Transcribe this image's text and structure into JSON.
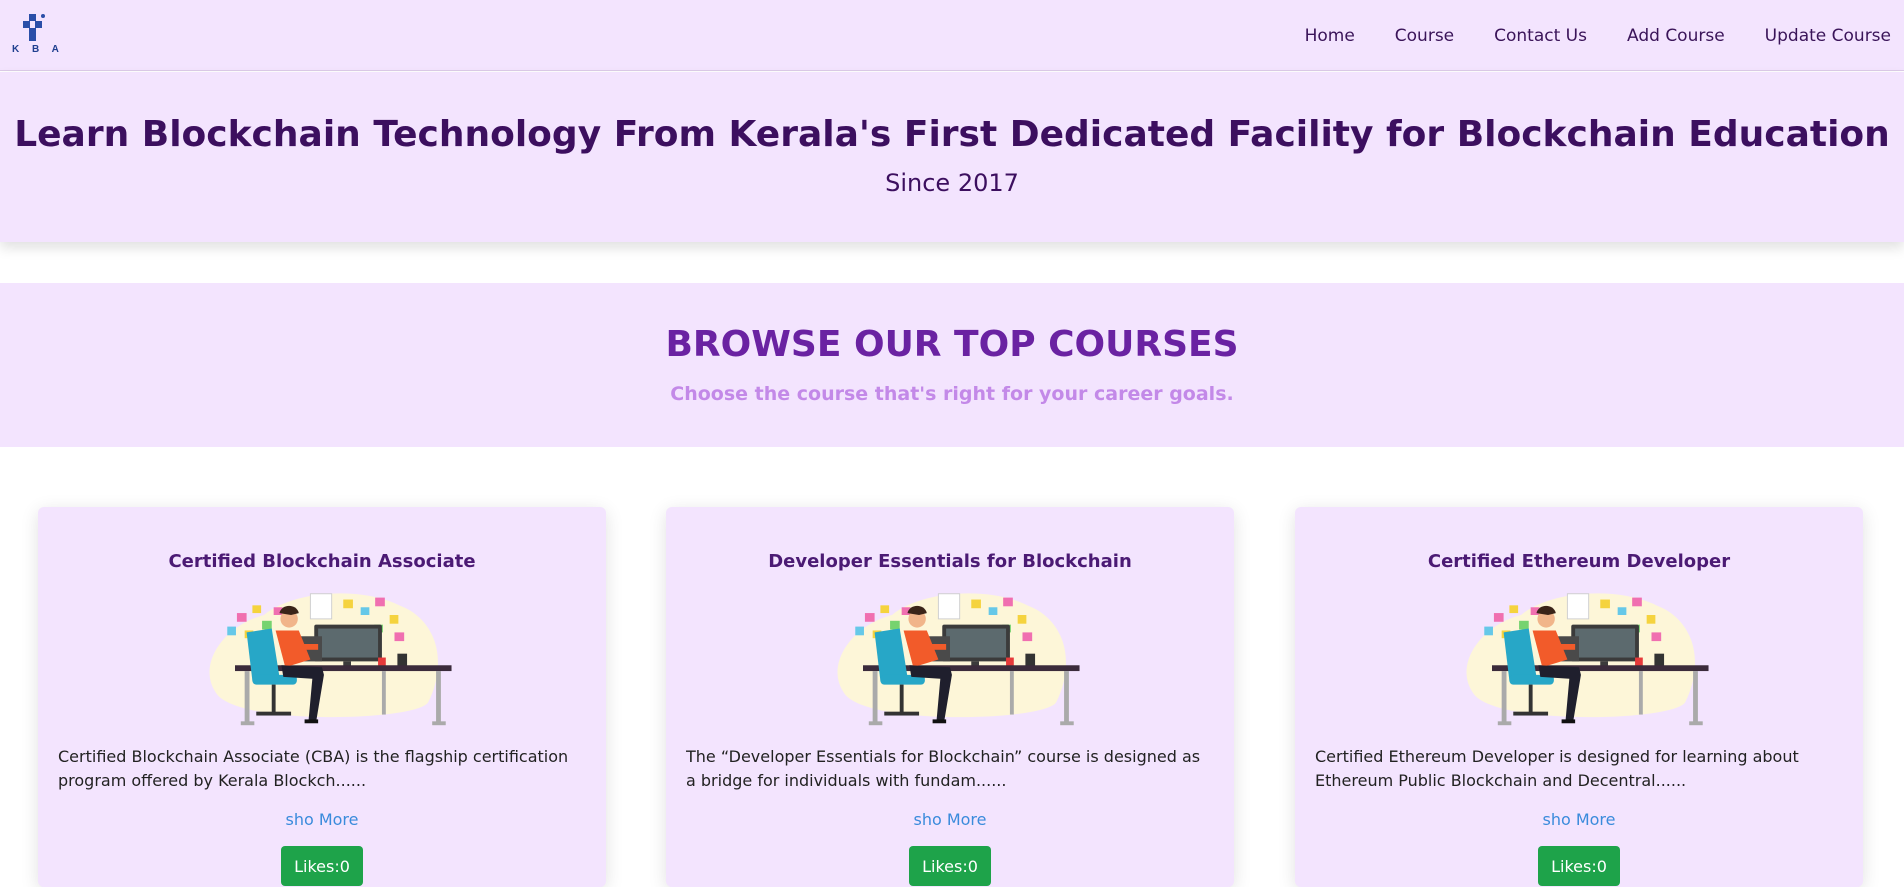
{
  "logo": {
    "text": "K B A",
    "icon": "kba-cube-logo-icon"
  },
  "nav": {
    "items": [
      "Home",
      "Course",
      "Contact Us",
      "Add Course",
      "Update Course"
    ]
  },
  "hero": {
    "title": "Learn Blockchain Technology From Kerala's First Dedicated Facility for Blockchain Education",
    "subtitle": "Since 2017"
  },
  "browse": {
    "title": "BROWSE OUR TOP COURSES",
    "subtitle": "Choose the course that's right for your career goals."
  },
  "courses": [
    {
      "title": "Certified Blockchain Associate",
      "description": "Certified Blockchain Associate (CBA) is the flagship certification program offered by Kerala Blockch......",
      "more_label": "sho More",
      "likes_label": "Likes:0"
    },
    {
      "title": "Developer Essentials for Blockchain",
      "description": "The “Developer Essentials for Blockchain” course is designed as a bridge for individuals with fundam......",
      "more_label": "sho More",
      "likes_label": "Likes:0"
    },
    {
      "title": "Certified Ethereum Developer",
      "description": "Certified Ethereum Developer is designed for learning about Ethereum Public Blockchain and Decentral......",
      "more_label": "sho More",
      "likes_label": "Likes:0"
    }
  ],
  "colors": {
    "page_bg": "#ffffff",
    "panel_bg": "#f3e4fe",
    "heading_dark": "#3c0f5f",
    "heading_purple": "#6a22a2",
    "subtitle_light_purple": "#c389e8",
    "link_blue": "#3a8bdc",
    "likes_green": "#1ea34a"
  }
}
